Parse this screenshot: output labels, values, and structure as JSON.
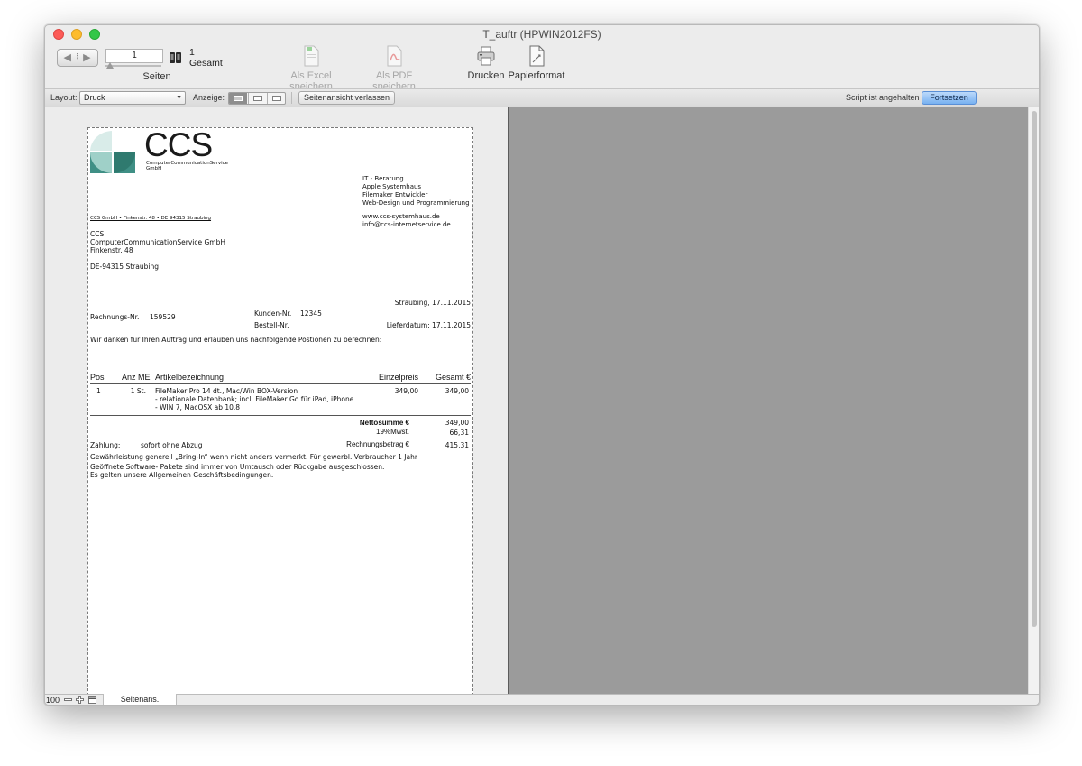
{
  "window": {
    "title": "T_auftr (HPWIN2012FS)"
  },
  "toolbar": {
    "page_value": "1",
    "page_total_value": "1",
    "page_total_label": "Gesamt",
    "pages_label": "Seiten",
    "excel_label": "Als Excel speichern",
    "pdf_label": "Als PDF speichern",
    "print_label": "Drucken",
    "paper_label": "Papierformat"
  },
  "formatbar": {
    "layout_label": "Layout:",
    "layout_value": "Druck",
    "view_label": "Anzeige:",
    "leave_preview_label": "Seitenansicht verlassen",
    "script_status": "Script ist angehalten",
    "continue_label": "Fortsetzen"
  },
  "statusbar": {
    "zoom": "100",
    "mode": "Seitenans."
  },
  "doc": {
    "logo_text": "CCS",
    "logo_sub1": "ComputerCommunicationService",
    "logo_sub2": "GmbH",
    "services": [
      "IT - Beratung",
      "Apple Systemhaus",
      "Filemaker Entwickler",
      "Web-Design und Programmierung"
    ],
    "web": "www.ccs-systemhaus.de",
    "email": "info@ccs-internetservice.de",
    "sender_line": "CCS GmbH •  Finkenstr. 48 • DE 94315 Straubing",
    "recipient": [
      "CCS",
      "ComputerCommunicationService GmbH",
      "Finkenstr. 48",
      "",
      "DE-94315 Straubing"
    ],
    "place_date": "Straubing,  17.11.2015",
    "invoice_label": "Rechnungs-Nr.",
    "invoice_no": "159529",
    "customer_label": "Kunden-Nr.",
    "customer_no": "12345",
    "order_label": "Bestell-Nr.",
    "delivery_date": "Lieferdatum: 17.11.2015",
    "intro": "Wir danken für Ihren Auftrag und erlauben uns nachfolgende Postionen zu berechnen:",
    "headers": {
      "pos": "Pos",
      "qty": "Anz ME",
      "article": "Artikelbezeichnung",
      "unit_price": "Einzelpreis",
      "total": "Gesamt €"
    },
    "items": [
      {
        "pos": "1",
        "qty": "1 St.",
        "desc": [
          "FileMaker Pro 14 dt., Mac/Win  BOX-Version",
          "- relationale Datenbank; incl. FileMaker Go für iPad, iPhone",
          "- WIN 7, MacOSX ab 10.8"
        ],
        "unit_price": "349,00",
        "total": "349,00"
      }
    ],
    "net_label": "Nettosumme €",
    "net_value": "349,00",
    "vat_label": "19%Mwst.",
    "vat_value": "66,31",
    "payment_label": "Zahlung:",
    "payment_value": "sofort ohne Abzug",
    "gross_label": "Rechnungsbetrag €",
    "gross_value": "415,31",
    "footer": [
      "Gewährleistung generell „Bring-In“ wenn nicht anders vermerkt. Für gewerbl. Verbraucher 1 Jahr",
      "Geöffnete Software- Pakete sind immer von Umtausch oder Rückgabe ausgeschlossen.",
      "Es gelten unsere Allgemeinen Geschäftsbedingungen."
    ]
  },
  "colors": {
    "logo_teal": "#3f8f85",
    "logo_light": "#9fd0c8",
    "continue_button": "#8cbcf3",
    "preview_gray": "#9b9b9b"
  }
}
